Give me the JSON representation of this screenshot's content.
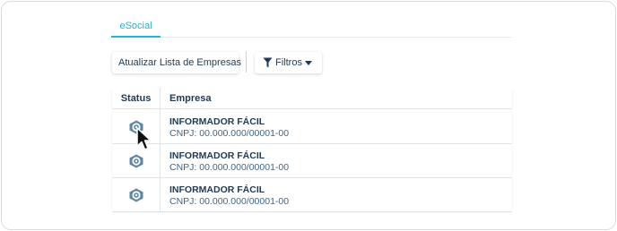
{
  "tabs": [
    {
      "label": "eSocial",
      "active": true
    }
  ],
  "toolbar": {
    "refresh_label": "Atualizar Lista de Empresas",
    "filter_label": "Filtros"
  },
  "table": {
    "headers": {
      "status": "Status",
      "empresa": "Empresa"
    },
    "rows": [
      {
        "status_icon": "esocial-target-icon",
        "name": "INFORMADOR FÁCIL",
        "cnpj": "CNPJ: 00.000.000/00001-00"
      },
      {
        "status_icon": "esocial-target-icon",
        "name": "INFORMADOR FÁCIL",
        "cnpj": "CNPJ: 00.000.000/00001-00"
      },
      {
        "status_icon": "esocial-target-icon",
        "name": "INFORMADOR FÁCIL",
        "cnpj": "CNPJ: 00.000.000/00001-00"
      }
    ]
  },
  "colors": {
    "accent": "#2ab3c9",
    "text_dark": "#1f3a52",
    "text_muted": "#3e6685",
    "icon": "#5e86a3"
  }
}
